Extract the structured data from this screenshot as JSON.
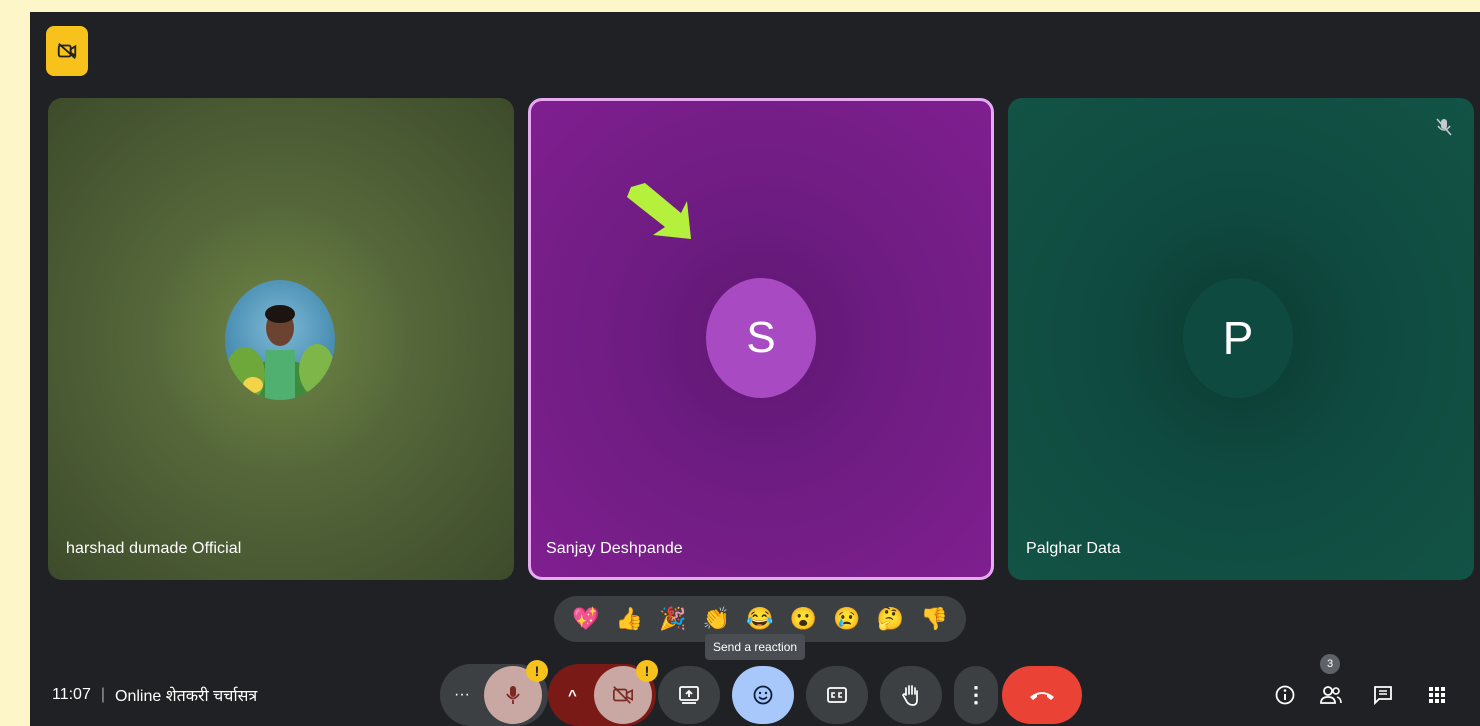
{
  "participants": [
    {
      "name": "harshad dumade Official",
      "initial": ""
    },
    {
      "name": "Sanjay Deshpande",
      "initial": "S"
    },
    {
      "name": "Palghar Data",
      "initial": "P"
    }
  ],
  "reactions": {
    "emojis": [
      "💖",
      "👍",
      "🎉",
      "👏",
      "😂",
      "😮",
      "😢",
      "🤔",
      "👎"
    ],
    "tooltip": "Send a reaction"
  },
  "meeting": {
    "time": "11:07",
    "separator": "|",
    "title": "Online शेतकरी चर्चासत्र"
  },
  "controls": {
    "more_label": "···",
    "warning_mark": "!",
    "chevron": "^",
    "options_label": "⋮",
    "end_call_color": "#ea4335"
  },
  "people_count": "3",
  "colors": {
    "active_speaker_border": "#e7a9f2",
    "warning": "#f6c21b",
    "reactions_button": "#a8c7fa"
  }
}
